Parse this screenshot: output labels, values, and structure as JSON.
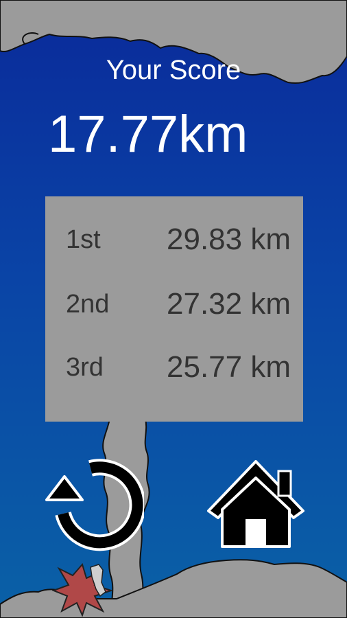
{
  "score": {
    "label": "Your Score",
    "value": "17.77km"
  },
  "leaderboard": [
    {
      "rank": "1st",
      "distance": "29.83 km"
    },
    {
      "rank": "2nd",
      "distance": "27.32 km"
    },
    {
      "rank": "3rd",
      "distance": "25.77 km"
    }
  ],
  "buttons": {
    "replay_icon": "replay-arrow-icon",
    "home_icon": "home-icon"
  },
  "colors": {
    "sky_top": "#0a2a9a",
    "sky_bottom": "#0a61a6",
    "cloud": "#9b9b9b",
    "board": "#9b9b9b",
    "text_light": "#ffffff",
    "text_dark": "#333333"
  }
}
